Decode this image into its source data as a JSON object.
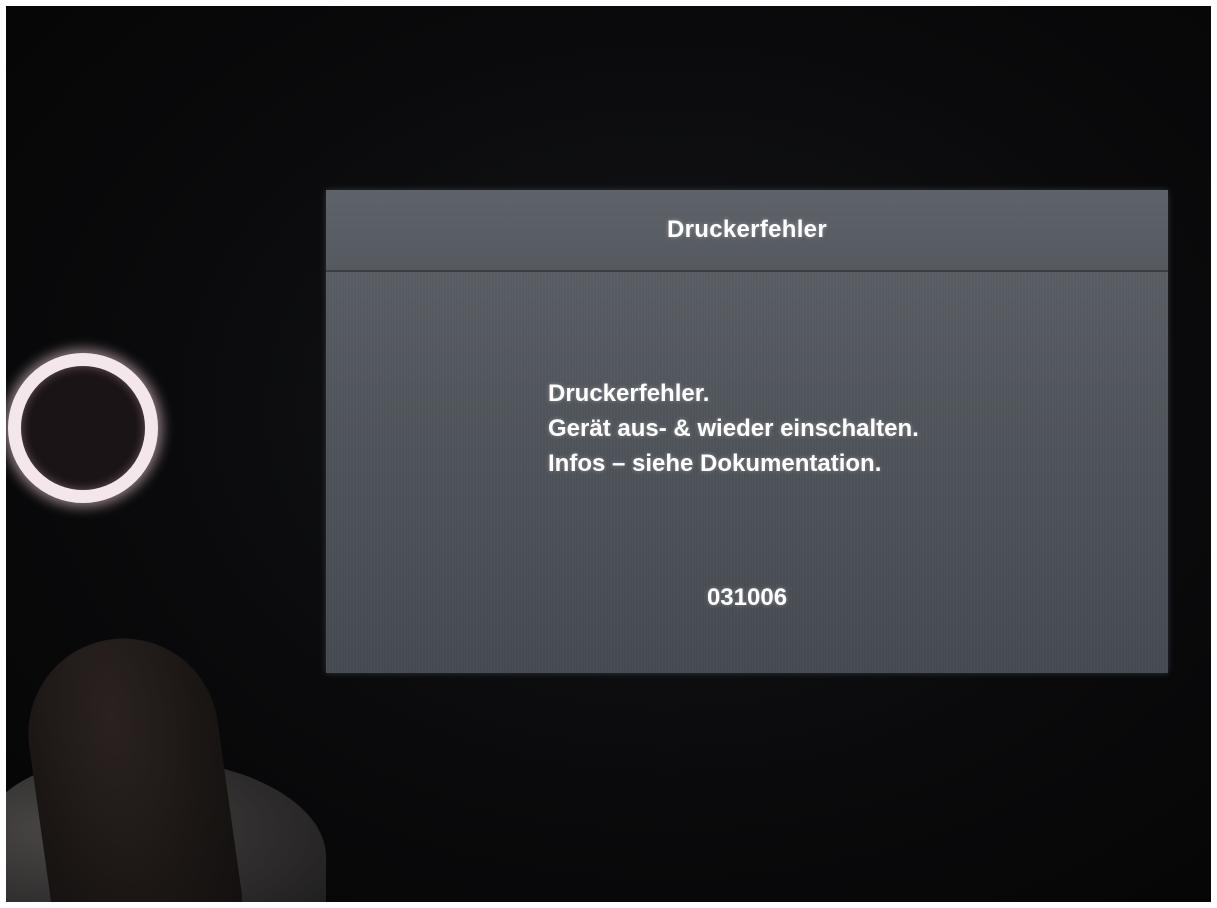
{
  "device": {
    "power_button_icon": "power-ring-icon",
    "power_ring_color": "#f4e7ec"
  },
  "screen": {
    "title": "Druckerfehler",
    "message_lines": [
      "Druckerfehler.",
      "Gerät aus- & wieder einschalten.",
      "Infos – siehe Dokumentation."
    ],
    "error_code": "031006",
    "background_color": "#555a60",
    "text_color": "#ffffff"
  }
}
